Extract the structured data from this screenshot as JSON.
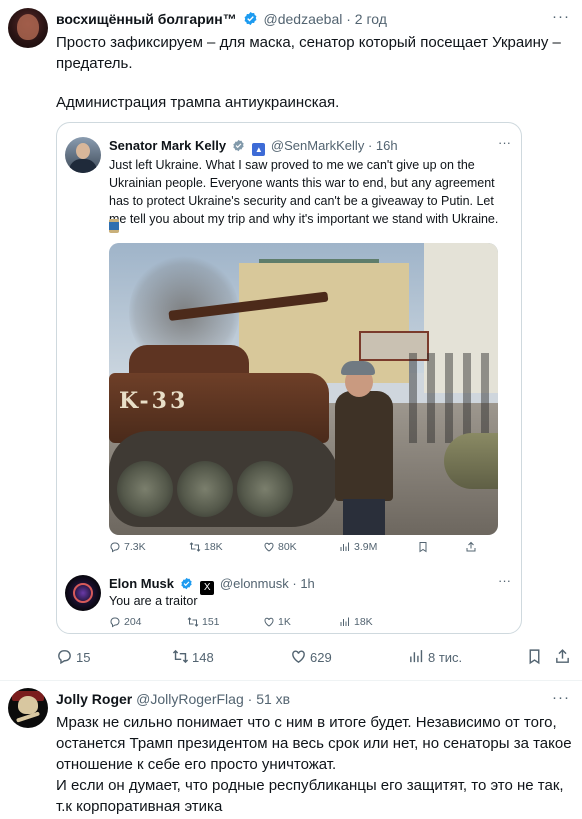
{
  "post1": {
    "author_name": "восхищённый болгарин™",
    "author_handle": "@dedzaebal",
    "time": "2 год",
    "more": "···",
    "text_line1": "Просто зафиксируем – для маска, сенатор который посещает Украину – предатель.",
    "text_line2": "Администрация трампа антиукраинская.",
    "quote": {
      "author_name": "Senator Mark Kelly",
      "author_handle": "@SenMarkKelly",
      "time": "16h",
      "text": "Just left Ukraine. What I saw proved to me we can't give up on the Ukrainian people. Everyone wants this war to end, but any agreement has to protect Ukraine's security and can't be a giveaway to Putin. Let me tell you about my trip and why it's important we stand with Ukraine.",
      "graffiti": "K-33",
      "actions": {
        "replies": "7.3K",
        "reposts": "18K",
        "likes": "80K",
        "views": "3.9M"
      },
      "reply": {
        "author_name": "Elon Musk",
        "author_handle": "@elonmusk",
        "time": "1h",
        "text": "You are a traitor",
        "actions": {
          "replies": "204",
          "reposts": "151",
          "likes": "1K",
          "views": "18K"
        }
      }
    },
    "actions": {
      "replies": "15",
      "reposts": "148",
      "likes": "629",
      "views": "8 тис."
    }
  },
  "post2": {
    "author_name": "Jolly Roger",
    "author_handle": "@JollyRogerFlag",
    "time": "51 хв",
    "more": "···",
    "text": "Мразк не сильно понимает что с ним в итоге будет. Независимо от того, останется Трамп президентом на весь срок или нет, но сенаторы за такое отношение к себе его просто уничтожат.\nИ если он думает, что родные республиканцы его защитят, то это не так, т.к корпоративная этика"
  },
  "colors": {
    "text": "#0f1419",
    "muted": "#536471",
    "verified_blue": "#1d9bf0",
    "border": "#cfd9de"
  }
}
